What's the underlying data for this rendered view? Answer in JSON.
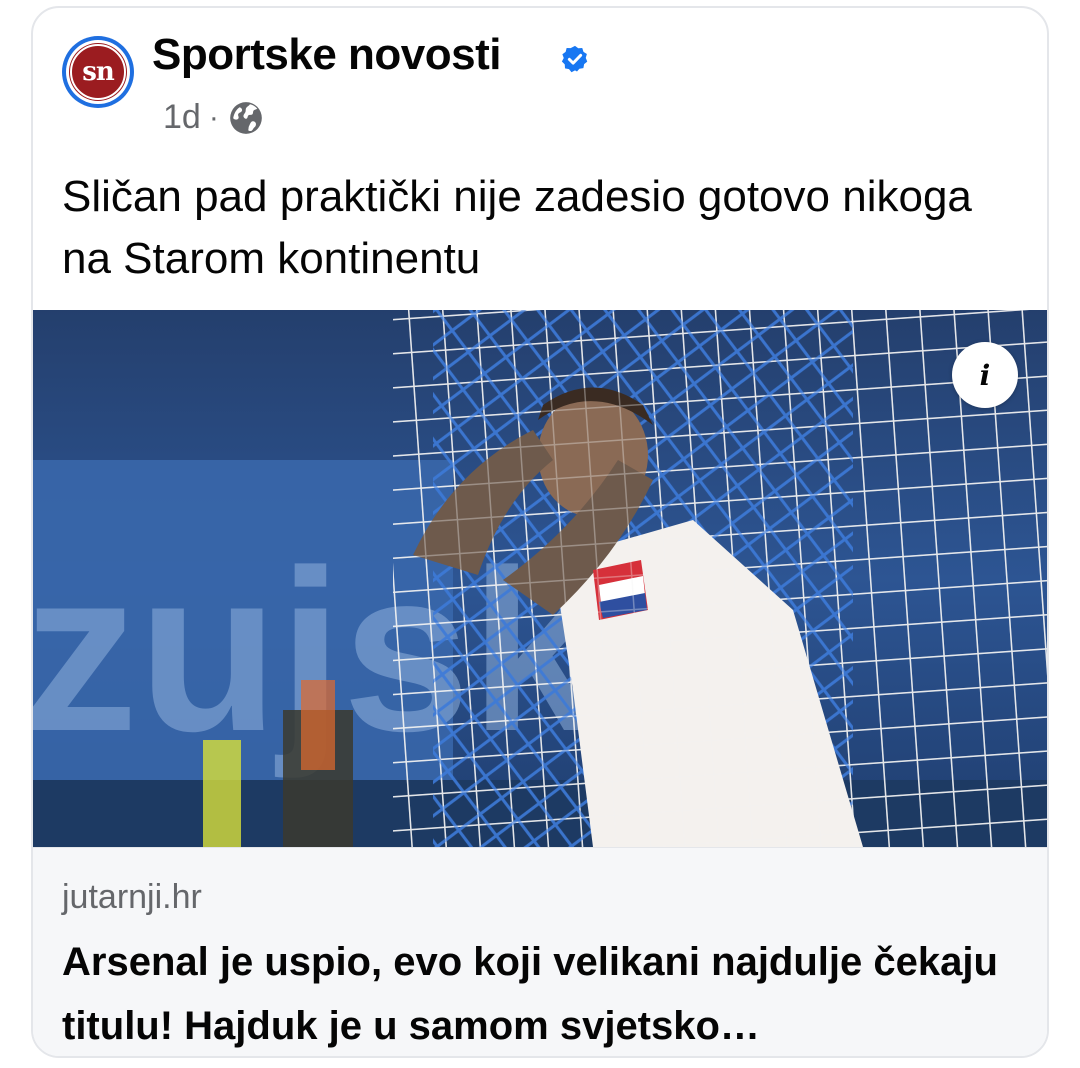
{
  "post": {
    "page_name": "Sportske novosti",
    "avatar_text": "sn",
    "verified_icon": "verified-badge-icon",
    "time": "1d",
    "separator": "·",
    "audience_icon": "globe-icon",
    "text": "Sličan pad praktički nije zadesio gotovo nikoga na Starom kontinentu"
  },
  "image": {
    "info_label": "i",
    "info_icon": "info-icon",
    "banner_text": "zujsk"
  },
  "link": {
    "domain": "jutarnji.hr",
    "title": "Arsenal je uspio, evo koji velikani najdulje čekaju titulu! Hajduk je u samom svjetsko…"
  },
  "colors": {
    "brand_blue": "#1f6fe0",
    "logo_red": "#9b1c20",
    "text_primary": "#050505",
    "text_secondary": "#65676b"
  }
}
